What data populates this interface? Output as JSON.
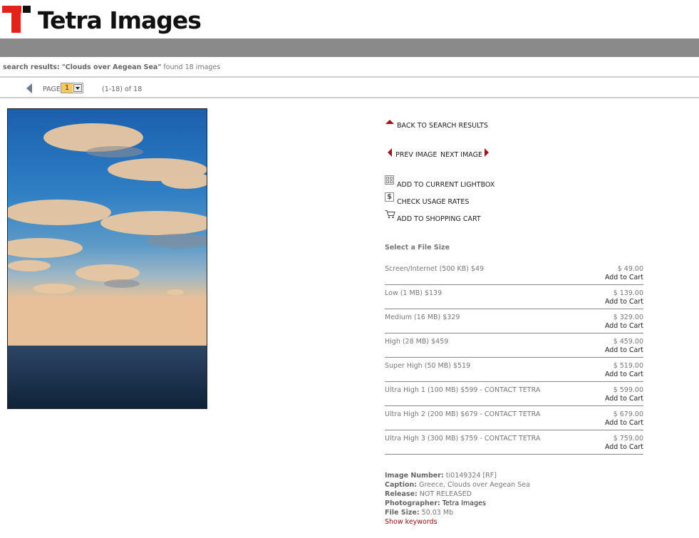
{
  "header": {
    "brand": "Tetra Images"
  },
  "search": {
    "prefix": "search results:",
    "query": "\"Clouds over Aegean Sea\"",
    "suffix": "found 18 images"
  },
  "pager": {
    "page_label": "PAGE",
    "page_value": "1",
    "range": "(1-18) of 18"
  },
  "actions": {
    "back": "BACK TO SEARCH RESULTS",
    "prev": "PREV IMAGE",
    "next": "NEXT IMAGE",
    "lightbox": "ADD TO CURRENT LIGHTBOX",
    "usage": "CHECK USAGE RATES",
    "usage_icon_glyph": "$",
    "cart": "ADD TO SHOPPING CART"
  },
  "sizes": {
    "title": "Select a File Size",
    "cart_label": "Add to Cart",
    "rows": [
      {
        "name": "Screen/Internet (500 KB) $49",
        "price": "$ 49.00"
      },
      {
        "name": "Low (1 MB) $139",
        "price": "$ 139.00"
      },
      {
        "name": "Medium (16 MB) $329",
        "price": "$ 329.00"
      },
      {
        "name": "High (28 MB) $459",
        "price": "$ 459.00"
      },
      {
        "name": "Super High (50 MB) $519",
        "price": "$ 519.00"
      },
      {
        "name": "Ultra High 1 (100 MB) $599 - CONTACT TETRA",
        "price": "$ 599.00"
      },
      {
        "name": "Ultra High 2 (200 MB) $679 - CONTACT TETRA",
        "price": "$ 679.00"
      },
      {
        "name": "Ultra High 3 (300 MB) $759 - CONTACT TETRA",
        "price": "$ 759.00"
      }
    ]
  },
  "meta": {
    "image_number_label": "Image Number:",
    "image_number": "ti0149324 [RF]",
    "caption_label": "Caption:",
    "caption": "Greece, Clouds over Aegean Sea",
    "release_label": "Release:",
    "release": "NOT RELEASED",
    "photographer_label": "Photographer:",
    "photographer": "Tetra Images",
    "file_size_label": "File Size:",
    "file_size": "50.03 Mb",
    "keywords_link": "Show keywords"
  },
  "colors": {
    "brand_red": "#e2231a",
    "bar_grey": "#8a8a8a",
    "arrow_red": "#a0141e"
  }
}
